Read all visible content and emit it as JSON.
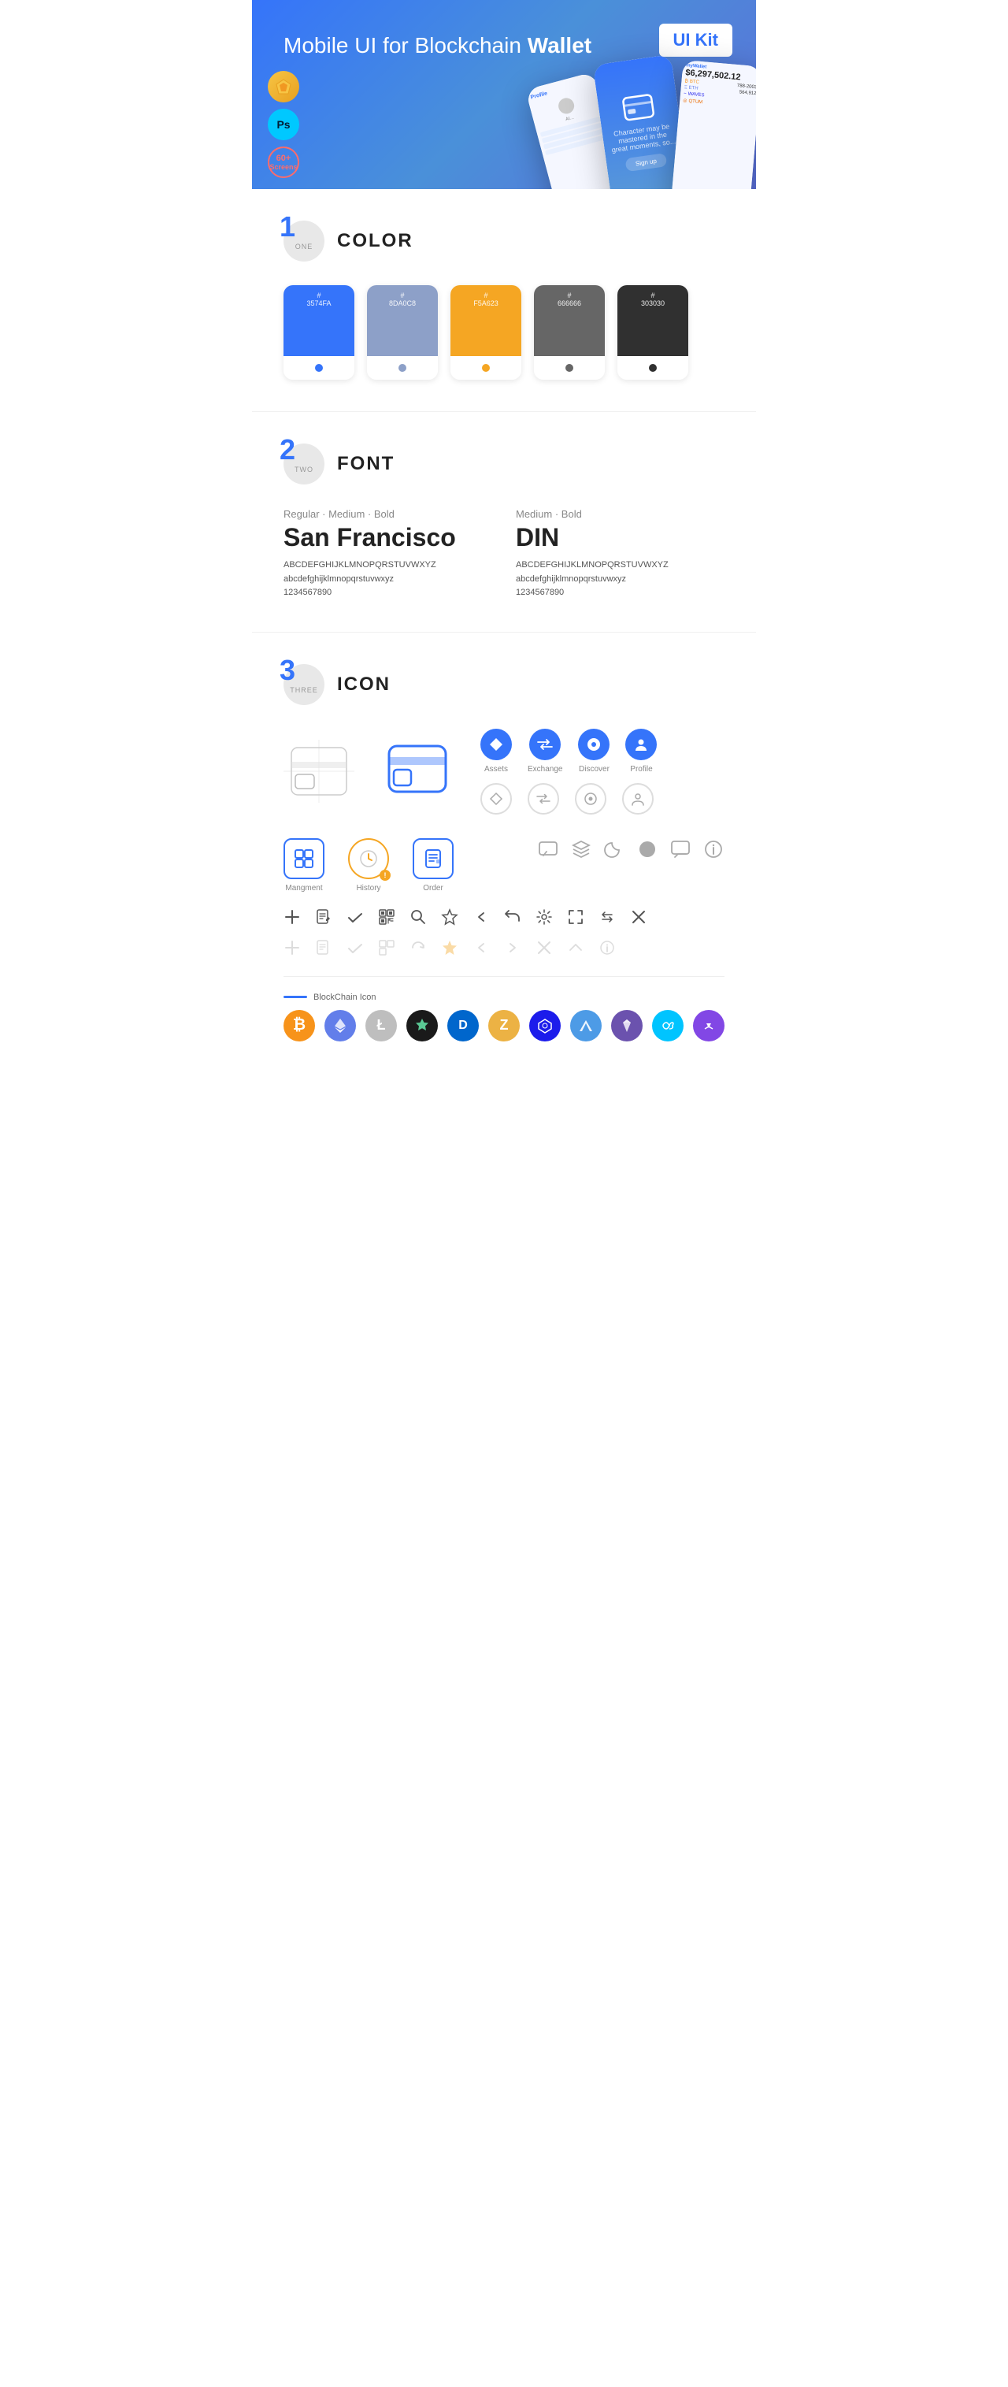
{
  "hero": {
    "title": "Mobile UI for Blockchain ",
    "title_bold": "Wallet",
    "badge": "UI Kit",
    "badge_sketch": "S",
    "badge_ps": "Ps",
    "badge_screens": "60+",
    "badge_screens_sub": "Screens"
  },
  "sections": {
    "color": {
      "number": "1",
      "number_label": "ONE",
      "title": "COLOR",
      "swatches": [
        {
          "hex": "#3574FA",
          "hex_label": "#\n3574FA",
          "dot_color": "#3574FA"
        },
        {
          "hex": "#8DA0C8",
          "hex_label": "#\n8DA0C8",
          "dot_color": "#8DA0C8"
        },
        {
          "hex": "#F5A623",
          "hex_label": "#\nF5A623",
          "dot_color": "#F5A623"
        },
        {
          "hex": "#666666",
          "hex_label": "#\n666666",
          "dot_color": "#666666"
        },
        {
          "hex": "#303030",
          "hex_label": "#\n303030",
          "dot_color": "#303030"
        }
      ]
    },
    "font": {
      "number": "2",
      "number_label": "TWO",
      "title": "FONT",
      "fonts": [
        {
          "label": "Regular · Medium · Bold",
          "name": "San Francisco",
          "upper": "ABCDEFGHIJKLMNOPQRSTUVWXYZ",
          "lower": "abcdefghijklmnopqrstuvwxyz",
          "nums": "1234567890"
        },
        {
          "label": "Medium · Bold",
          "name": "DIN",
          "upper": "ABCDEFGHIJKLMNOPQRSTUVWXYZ",
          "lower": "abcdefghijklmnopqrstuvwxyz",
          "nums": "1234567890"
        }
      ]
    },
    "icon": {
      "number": "3",
      "number_label": "THREE",
      "title": "ICON",
      "nav_icons": [
        {
          "label": "Assets",
          "symbol": "◆"
        },
        {
          "label": "Exchange",
          "symbol": "⇄"
        },
        {
          "label": "Discover",
          "symbol": "●"
        },
        {
          "label": "Profile",
          "symbol": "👤"
        }
      ],
      "app_icons": [
        {
          "label": "Mangment",
          "symbol": "▦"
        },
        {
          "label": "History",
          "symbol": "🕐"
        },
        {
          "label": "Order",
          "symbol": "📋"
        }
      ],
      "misc_icons": [
        "💬",
        "≡",
        "☰",
        "◗",
        "●",
        "💬",
        "ℹ"
      ],
      "action_icons": [
        "+",
        "📄",
        "✓",
        "▦",
        "🔍",
        "☆",
        "‹",
        "‹",
        "⚙",
        "⬜",
        "⬜",
        "✕"
      ],
      "blockchain_label": "BlockChain Icon",
      "blockchain_icons": [
        {
          "symbol": "₿",
          "bg": "#F7931A",
          "color": "#fff"
        },
        {
          "symbol": "Ξ",
          "bg": "#627EEA",
          "color": "#fff"
        },
        {
          "symbol": "Ł",
          "bg": "#BFBBBB",
          "color": "#fff"
        },
        {
          "symbol": "✦",
          "bg": "#1A1A1A",
          "color": "#5AC994"
        },
        {
          "symbol": "Ð",
          "bg": "#0066CC",
          "color": "#fff"
        },
        {
          "symbol": "Z",
          "bg": "#ECB244",
          "color": "#fff"
        },
        {
          "symbol": "⬡",
          "bg": "#1C1CEB",
          "color": "#fff"
        },
        {
          "symbol": "▲",
          "bg": "#4D9BE6",
          "color": "#fff"
        },
        {
          "symbol": "◆",
          "bg": "#6B52AE",
          "color": "#fff"
        },
        {
          "symbol": "◈",
          "bg": "#00C4FF",
          "color": "#fff"
        },
        {
          "symbol": "∞",
          "bg": "#8247E5",
          "color": "#fff"
        }
      ]
    }
  }
}
